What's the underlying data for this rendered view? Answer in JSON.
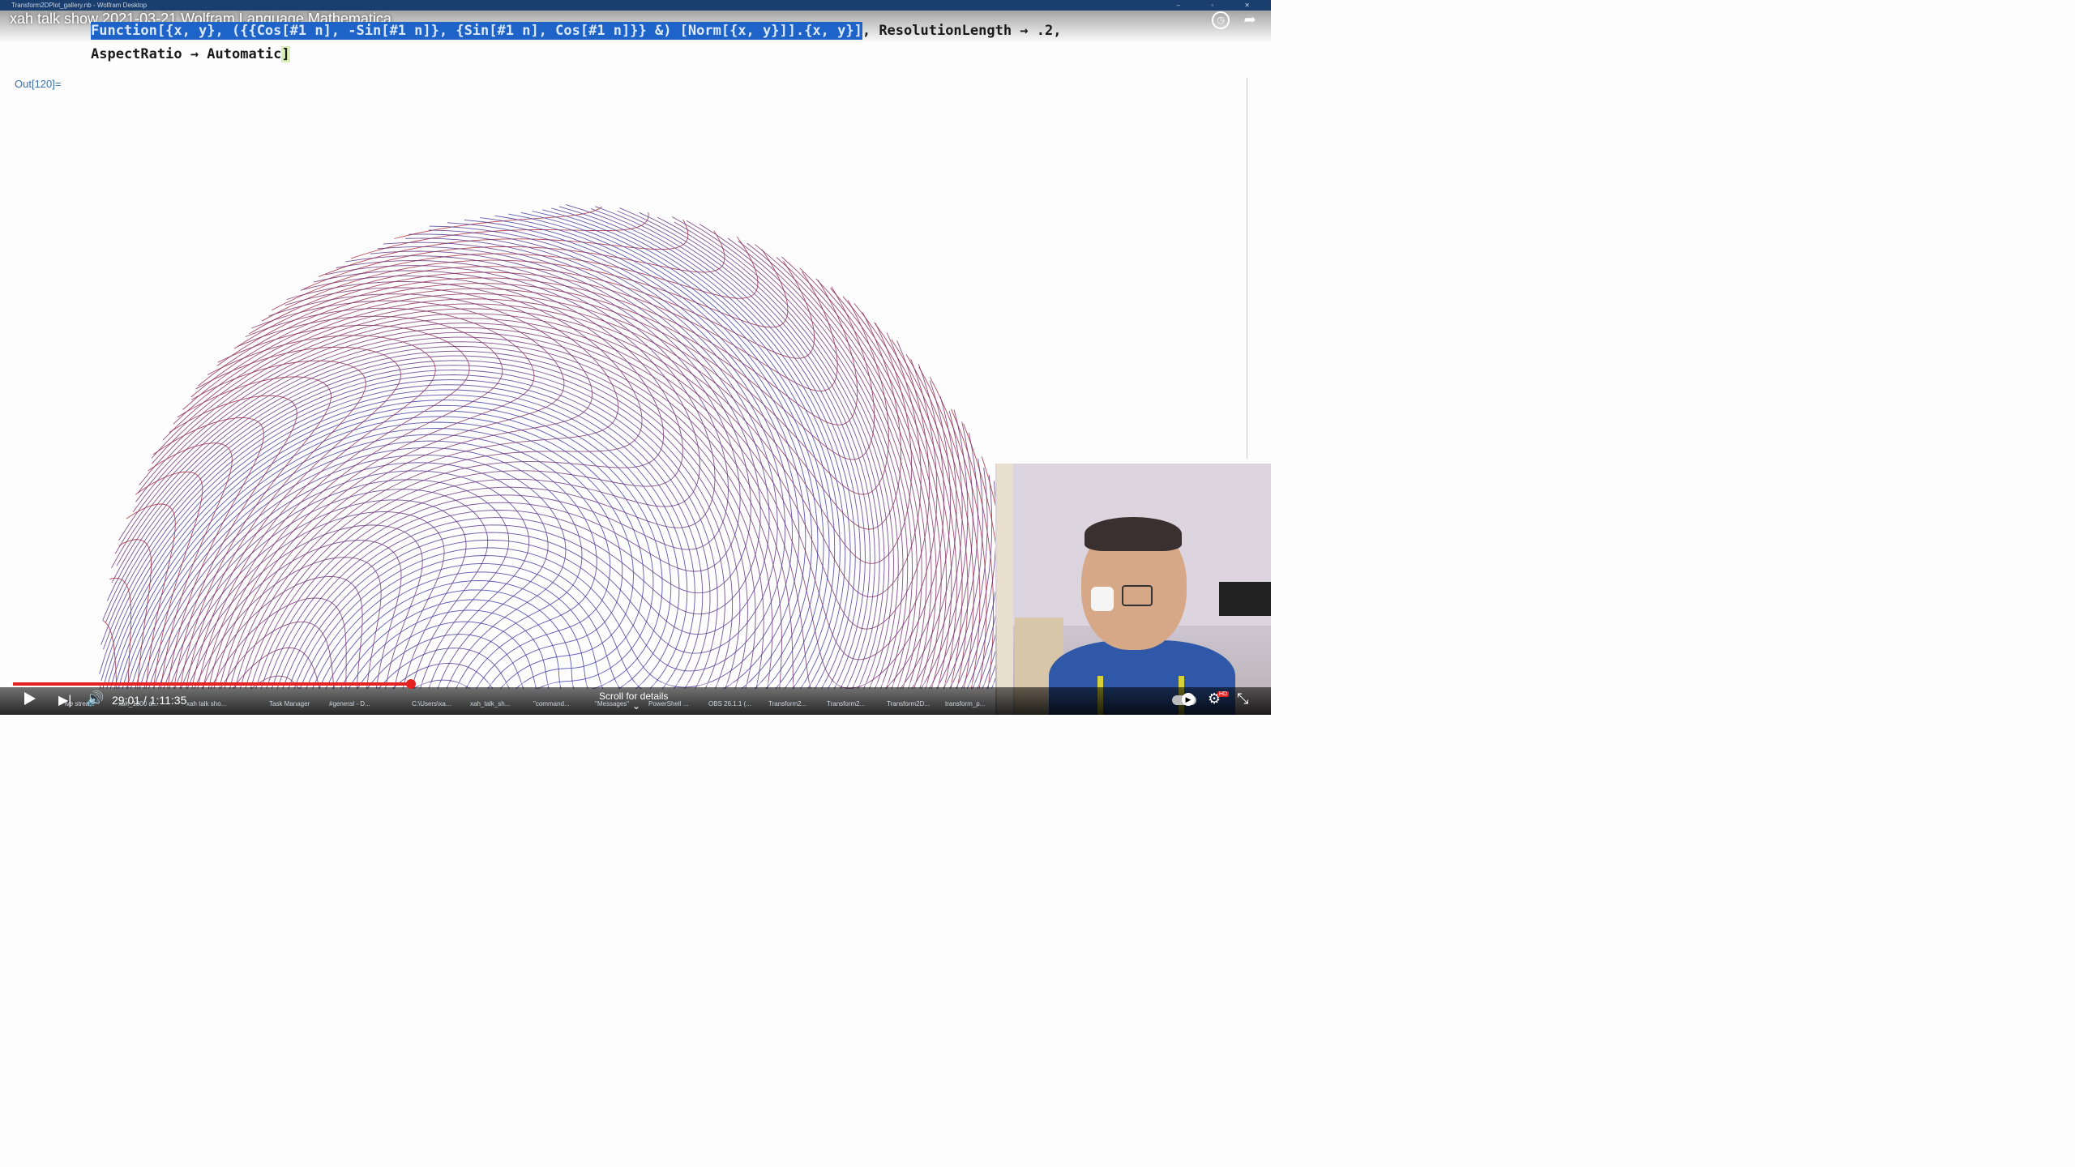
{
  "window": {
    "title": "Transform2DPlot_gallery.nb - Wolfram Desktop",
    "controls": "– ▫ ✕"
  },
  "video": {
    "title": "xah talk show 2021-03-21 Wolfram Language Mathematica",
    "current_time": "29:01",
    "duration": "1:11:35",
    "time_display": "29:01 / 1:11:35",
    "progress_fraction": 0.4053,
    "scroll_hint": "Scroll for details",
    "hd_badge": "HD"
  },
  "notebook": {
    "code_highlighted": "Function[{x, y}, ({{Cos[#1 n], -Sin[#1 n]}, {Sin[#1 n], Cos[#1 n]}} &) [Norm[{x, y}]].{x, y}]",
    "code_line1_rest": ", ResolutionLength → .2,",
    "code_line2": "AspectRatio → Automatic",
    "code_line2_bracket": "]",
    "out_label": "Out[120]="
  },
  "taskbar": [
    {
      "label": "ive strea..."
    },
    {
      "label": "xah_1300 d..."
    },
    {
      "label": "xah talk sho..."
    },
    {
      "label": "Task Manager"
    },
    {
      "label": "#general - D..."
    },
    {
      "label": "C:\\Users\\xa..."
    },
    {
      "label": "xah_talk_sh..."
    },
    {
      "label": "\"command..."
    },
    {
      "label": "\"Messages\""
    },
    {
      "label": "PowerShell ..."
    },
    {
      "label": "OBS 26.1.1 (..."
    },
    {
      "label": "Transform2..."
    },
    {
      "label": "Transform2..."
    },
    {
      "label": "Transform2D..."
    },
    {
      "label": "transform_p..."
    }
  ],
  "colors": {
    "highlight": "#1e64c8",
    "inner_lines": "#3a3aa8",
    "outer_lines": "#b02a2a",
    "progress": "#e52222"
  }
}
